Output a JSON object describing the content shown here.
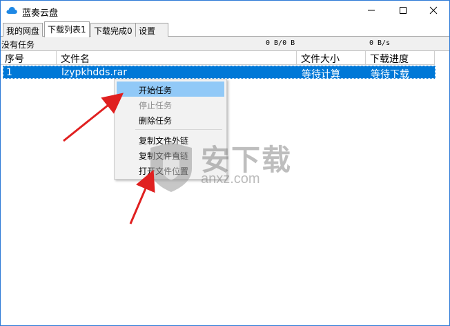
{
  "window": {
    "title": "蓝奏云盘"
  },
  "tabs": [
    {
      "label": "我的网盘"
    },
    {
      "label": "下载列表1"
    },
    {
      "label": "下载完成0"
    },
    {
      "label": "设置"
    }
  ],
  "status": {
    "text": "没有任务",
    "size": "0 B/0 B",
    "speed": "0 B/s"
  },
  "table": {
    "columns": [
      "序号",
      "文件名",
      "文件大小",
      "下载进度"
    ],
    "rows": [
      {
        "index": "1",
        "filename": "lzypkhdds.rar",
        "size": "等待计算",
        "progress": "等待下载"
      }
    ]
  },
  "context_menu": {
    "items": [
      "开始任务",
      "停止任务",
      "删除任务",
      "复制文件外链",
      "复制文件直链",
      "打开文件位置"
    ]
  },
  "watermark": {
    "text": "安下载",
    "url": "anxz.com"
  },
  "colors": {
    "selection": "#0078d7",
    "menu_hover": "#91c9f7",
    "arrow": "#e02020",
    "cloud_icon": "#1e88e5"
  },
  "icons": [
    "cloud-icon",
    "minimize-icon",
    "maximize-icon",
    "close-icon",
    "shield-icon"
  ]
}
